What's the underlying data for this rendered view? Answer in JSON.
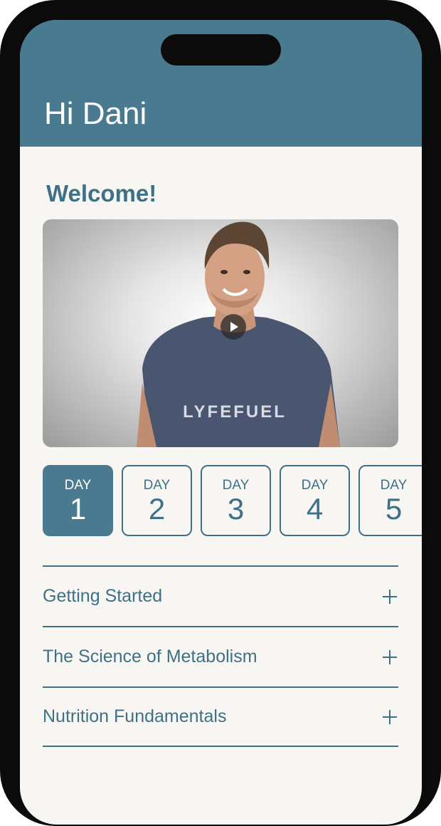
{
  "header": {
    "greeting": "Hi Dani"
  },
  "welcome": {
    "title": "Welcome!"
  },
  "video": {
    "shirt_text": "LYFEFUEL",
    "play_icon": "play-icon"
  },
  "days": [
    {
      "label": "DAY",
      "number": "1",
      "active": true
    },
    {
      "label": "DAY",
      "number": "2",
      "active": false
    },
    {
      "label": "DAY",
      "number": "3",
      "active": false
    },
    {
      "label": "DAY",
      "number": "4",
      "active": false
    },
    {
      "label": "DAY",
      "number": "5",
      "active": false
    }
  ],
  "sections": [
    {
      "label": "Getting Started",
      "icon": "plus-icon"
    },
    {
      "label": "The Science of Metabolism",
      "icon": "plus-icon"
    },
    {
      "label": "Nutrition Fundamentals",
      "icon": "plus-icon"
    }
  ],
  "colors": {
    "header": "#4a7a8f",
    "accent": "#3f7186",
    "background": "#f7f6f2",
    "frame": "#0b0b0b"
  }
}
